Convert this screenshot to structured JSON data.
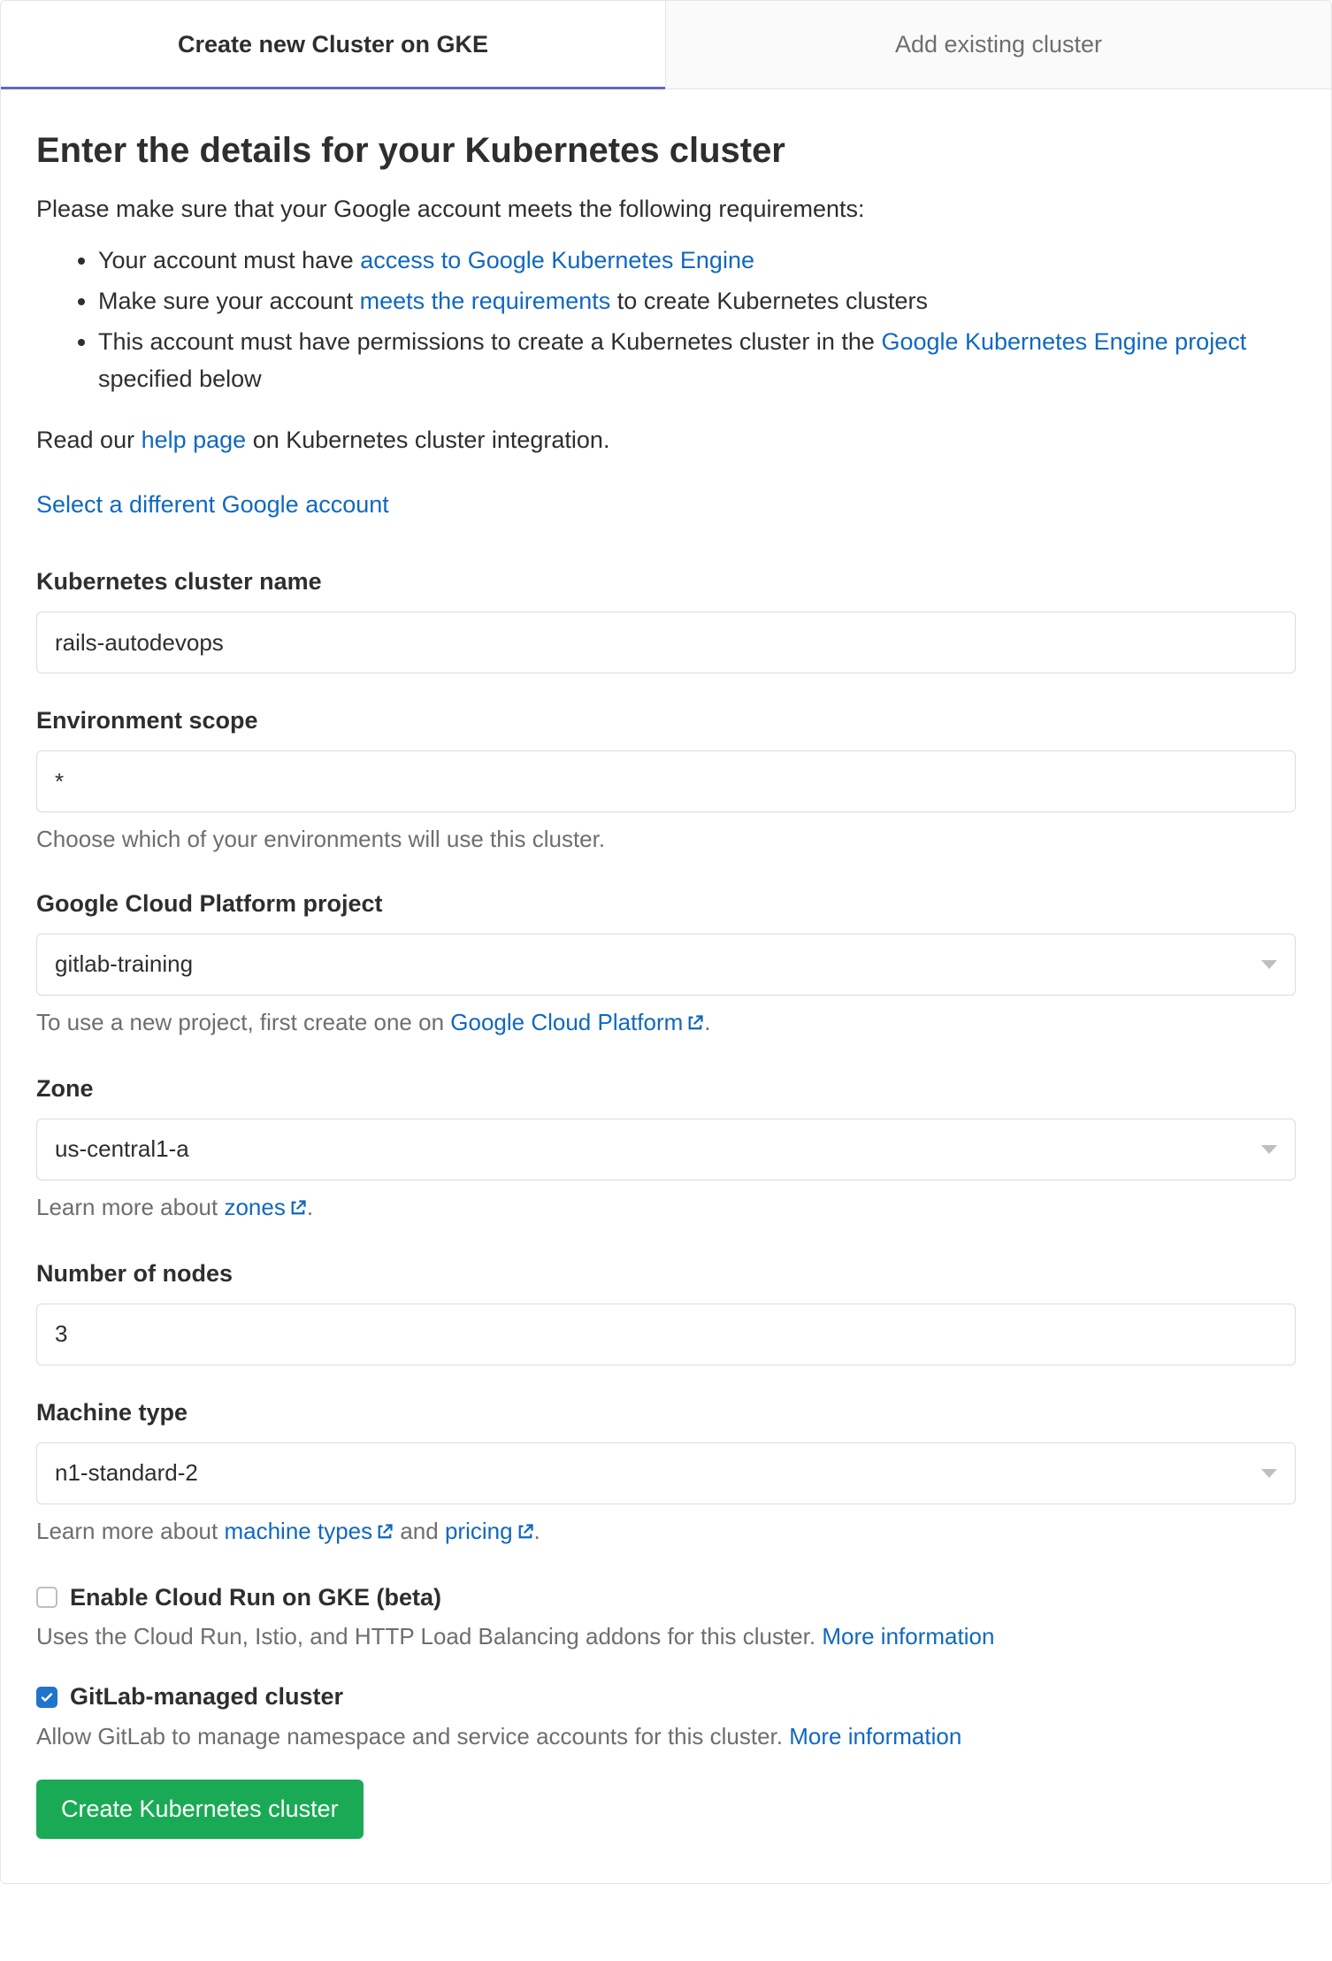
{
  "tabs": {
    "create": "Create new Cluster on GKE",
    "add": "Add existing cluster"
  },
  "heading": "Enter the details for your Kubernetes cluster",
  "intro": {
    "lead": "Please make sure that your Google account meets the following requirements:",
    "req1_prefix": "Your account must have ",
    "req1_link": "access to Google Kubernetes Engine",
    "req2_prefix": "Make sure your account ",
    "req2_link": "meets the requirements",
    "req2_suffix": " to create Kubernetes clusters",
    "req3_prefix": "This account must have permissions to create a Kubernetes cluster in the ",
    "req3_link": "Google Kubernetes Engine project",
    "req3_suffix": " specified below",
    "read_prefix": "Read our ",
    "read_link": "help page",
    "read_suffix": " on Kubernetes cluster integration.",
    "select_account": "Select a different Google account"
  },
  "form": {
    "cluster_name": {
      "label": "Kubernetes cluster name",
      "value": "rails-autodevops"
    },
    "env_scope": {
      "label": "Environment scope",
      "value": "*",
      "help": "Choose which of your environments will use this cluster."
    },
    "gcp_project": {
      "label": "Google Cloud Platform project",
      "value": "gitlab-training",
      "help_prefix": "To use a new project, first create one on ",
      "help_link": "Google Cloud Platform",
      "help_suffix": "."
    },
    "zone": {
      "label": "Zone",
      "value": "us-central1-a",
      "help_prefix": "Learn more about ",
      "help_link": "zones",
      "help_suffix": "."
    },
    "nodes": {
      "label": "Number of nodes",
      "value": "3"
    },
    "machine_type": {
      "label": "Machine type",
      "value": "n1-standard-2",
      "help_prefix": "Learn more about ",
      "help_link1": "machine types",
      "help_mid": " and ",
      "help_link2": "pricing",
      "help_suffix": "."
    },
    "cloud_run": {
      "label": "Enable Cloud Run on GKE (beta)",
      "help": "Uses the Cloud Run, Istio, and HTTP Load Balancing addons for this cluster. ",
      "more": "More information",
      "checked": false
    },
    "managed": {
      "label": "GitLab-managed cluster",
      "help": "Allow GitLab to manage namespace and service accounts for this cluster. ",
      "more": "More information",
      "checked": true
    },
    "submit": "Create Kubernetes cluster"
  }
}
